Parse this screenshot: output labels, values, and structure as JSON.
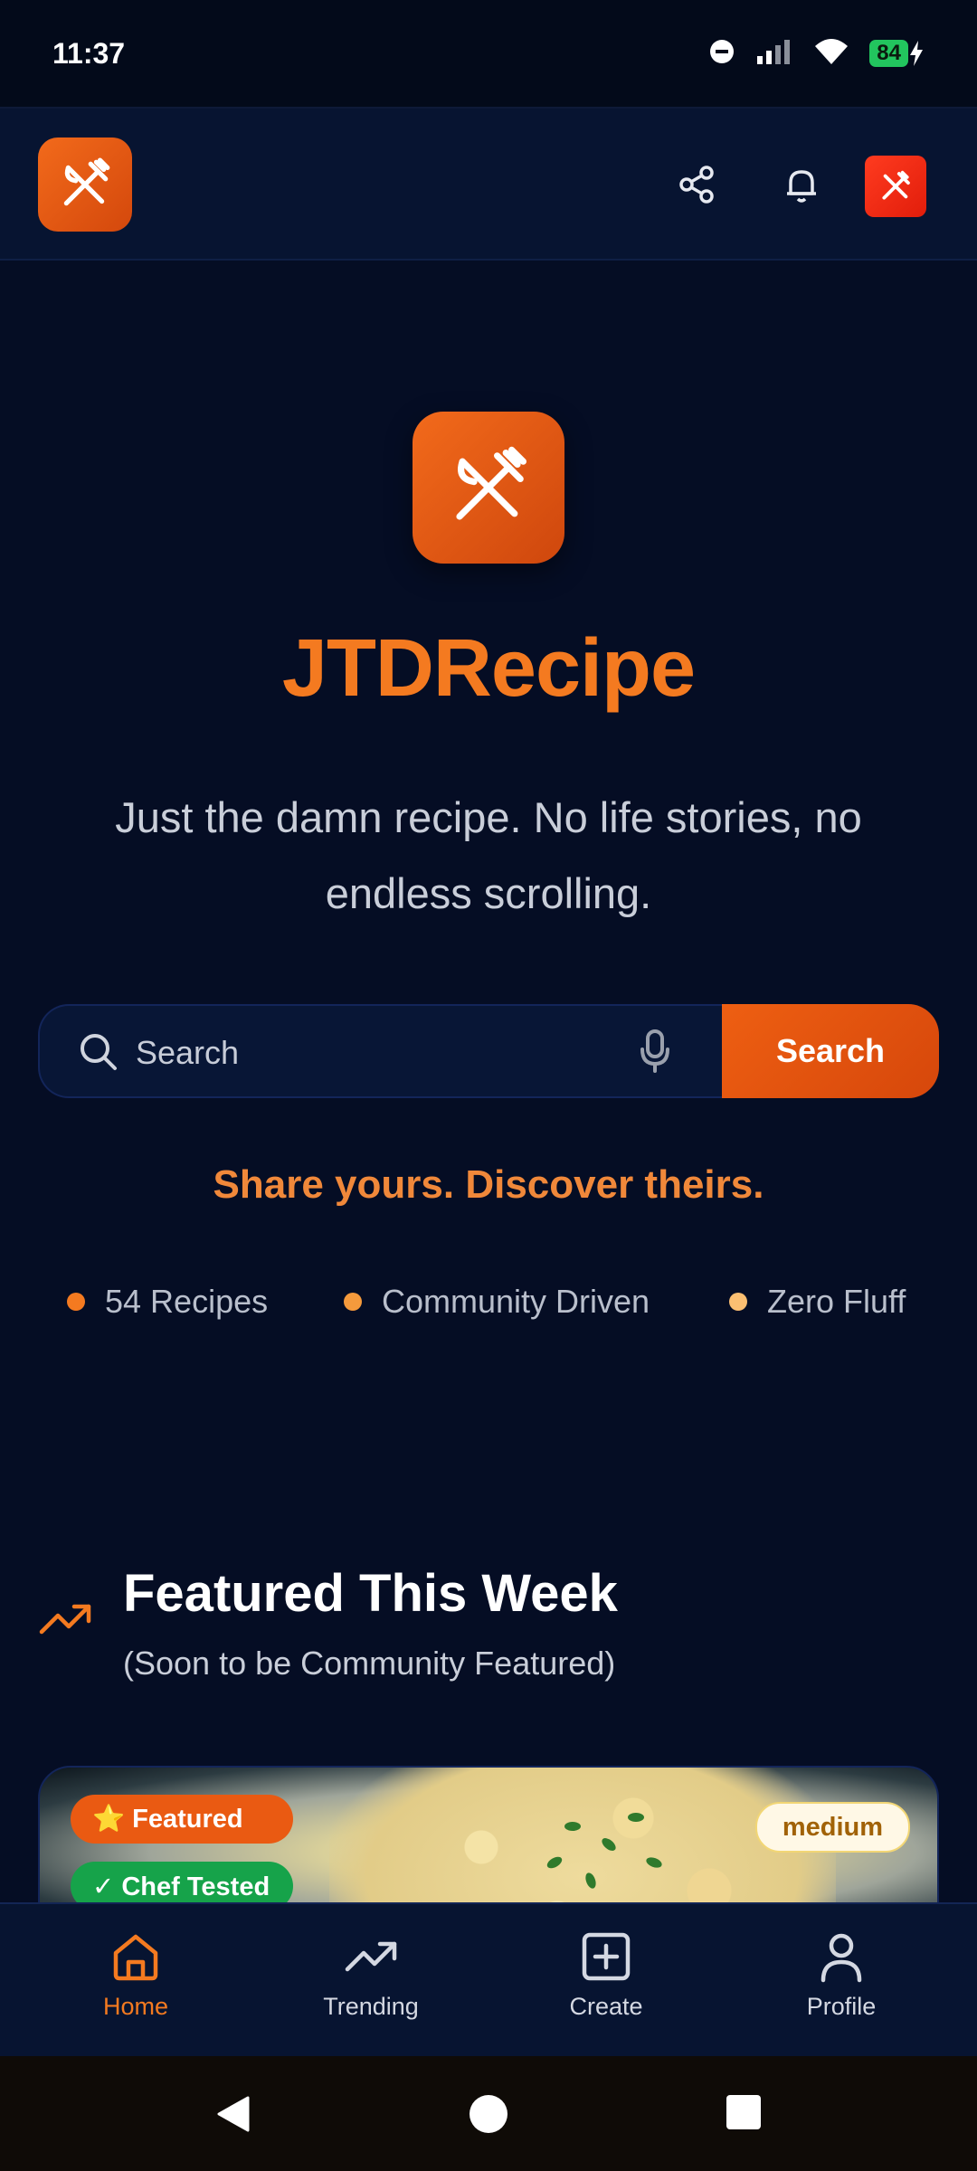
{
  "status_bar": {
    "time": "11:37",
    "battery": "84"
  },
  "header": {
    "logo_icon": "fork-knife-icon",
    "share_icon": "share-icon",
    "bell_icon": "bell-icon",
    "avatar_icon": "fork-knife-icon"
  },
  "hero": {
    "title": "JTDRecipe",
    "tagline": "Just the damn recipe. No life stories, no endless scrolling."
  },
  "search": {
    "placeholder": "Search",
    "button_label": "Search"
  },
  "share_line": "Share yours. Discover theirs.",
  "stats": [
    {
      "label": "54 Recipes",
      "color": "#f47a20"
    },
    {
      "label": "Community Driven",
      "color": "#f59a3c"
    },
    {
      "label": "Zero Fluff",
      "color": "#fbbf72"
    }
  ],
  "featured": {
    "title": "Featured This Week",
    "subtitle": "(Soon to be Community Featured)",
    "card": {
      "badges": {
        "featured": "⭐ Featured",
        "chef": "✓ Chef Tested"
      },
      "difficulty": "medium"
    }
  },
  "bottom_nav": {
    "items": [
      {
        "label": "Home",
        "icon": "home-icon",
        "active": true
      },
      {
        "label": "Trending",
        "icon": "trending-icon",
        "active": false
      },
      {
        "label": "Create",
        "icon": "plus-square-icon",
        "active": false
      },
      {
        "label": "Profile",
        "icon": "user-icon",
        "active": false
      }
    ]
  },
  "colors": {
    "accent": "#f47a20",
    "background": "#050d24",
    "success": "#16a34a"
  }
}
